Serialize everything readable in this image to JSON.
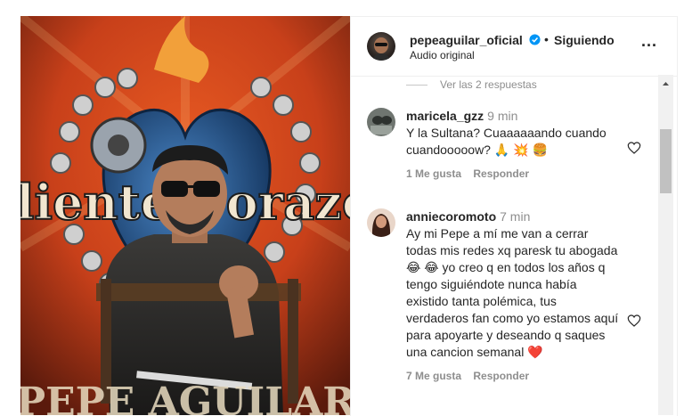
{
  "header": {
    "username": "pepeaguilar_oficial",
    "separator": "•",
    "follow_status": "Siguiendo",
    "audio": "Audio original",
    "more": "..."
  },
  "media": {
    "banner_text": "liente Corazón",
    "bottom_text": "PEPE AGUILAR"
  },
  "comments": {
    "view_replies": "Ver las 2 respuestas",
    "items": [
      {
        "user": "maricela_gzz",
        "time": "9 min",
        "text": "Y la Sultana? Cuaaaaaando cuando cuandooooow? 🙏 💥 🍔",
        "likes": "1 Me gusta",
        "reply": "Responder"
      },
      {
        "user": "anniecoromoto",
        "time": "7 min",
        "text": "Ay mi Pepe a mí me van a cerrar todas mis redes xq paresk tu abogada 😂 😂 yo creo q en todos los años q tengo siguiéndote nunca había existido tanta polémica, tus verdaderos fan como yo estamos aquí para apoyarte y deseando q saques una cancion semanal ❤️",
        "likes": "7 Me gusta",
        "reply": "Responder"
      }
    ]
  },
  "colors": {
    "verified_blue": "#0095f6",
    "muted_text": "#8e8e8e",
    "primary_text": "#262626",
    "poster_orange": "#d7461c"
  }
}
